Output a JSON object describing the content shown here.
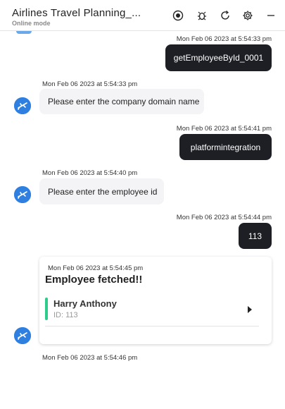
{
  "header": {
    "title": "Airlines Travel Planning_...",
    "subtitle": "Online mode",
    "icons": [
      "record-icon",
      "bug-icon",
      "refresh-icon",
      "gear-icon",
      "minimize-icon"
    ]
  },
  "messages": [
    {
      "from": "user",
      "timestamp": "Mon Feb 06 2023 at 5:54:33 pm",
      "text": "getEmployeeById_0001"
    },
    {
      "from": "bot",
      "timestamp": "Mon Feb 06 2023 at 5:54:33 pm",
      "text": "Please enter the company domain name"
    },
    {
      "from": "user",
      "timestamp": "Mon Feb 06 2023 at 5:54:41 pm",
      "text": "platformintegration"
    },
    {
      "from": "bot",
      "timestamp": "Mon Feb 06 2023 at 5:54:40 pm",
      "text": "Please enter the employee id"
    },
    {
      "from": "user",
      "timestamp": "Mon Feb 06 2023 at 5:54:44 pm",
      "text": "113"
    }
  ],
  "card": {
    "timestamp": "Mon Feb 06 2023 at 5:54:45 pm",
    "title": "Employee fetched!!",
    "employee_name": "Harry Anthony",
    "employee_id": "ID: 113"
  },
  "last_timestamp": "Mon Feb 06 2023 at 5:54:46 pm",
  "colors": {
    "user_bubble": "#1d1f24",
    "bot_bubble": "#f4f4f6",
    "avatar": "#2f7fe0",
    "status_bar": "#2ecc8a"
  }
}
